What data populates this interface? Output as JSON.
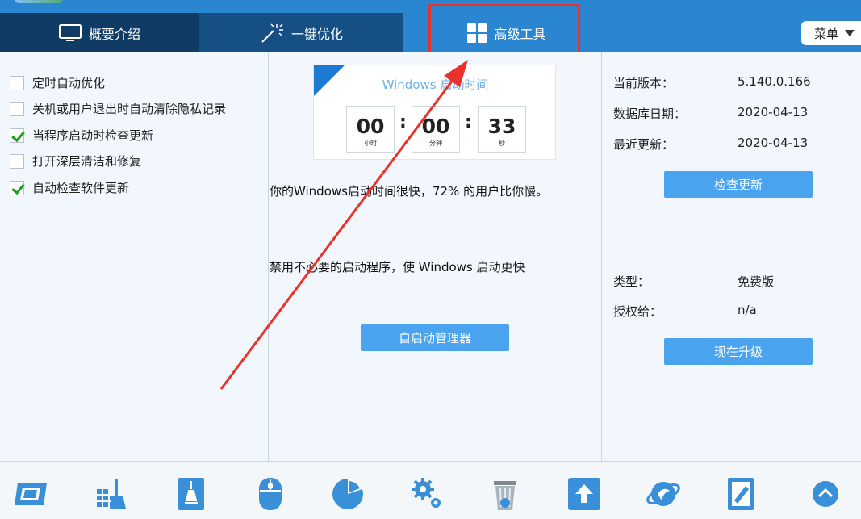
{
  "tabs": [
    {
      "label": "概要介绍",
      "icon": "monitor-icon"
    },
    {
      "label": "一键优化",
      "icon": "magic-wand-icon"
    },
    {
      "label": "高级工具",
      "icon": "grid-icon"
    }
  ],
  "menu": {
    "label": "菜单"
  },
  "options": [
    {
      "label": "定时自动优化",
      "checked": false
    },
    {
      "label": "关机或用户退出时自动清除隐私记录",
      "checked": false
    },
    {
      "label": "当程序启动时检查更新",
      "checked": true
    },
    {
      "label": "打开深层清洁和修复",
      "checked": false
    },
    {
      "label": "自动检查软件更新",
      "checked": true
    }
  ],
  "boot": {
    "title": "Windows 启动时间",
    "hours": "00",
    "hours_unit": "小时",
    "minutes": "00",
    "minutes_unit": "分钟",
    "seconds": "33",
    "seconds_unit": "秒",
    "message": "你的Windows启动时间很快，72% 的用户比你慢。",
    "tip": "禁用不必要的启动程序，使 Windows 启动更快",
    "button": "自启动管理器"
  },
  "info": {
    "version_label": "当前版本：",
    "version": "5.140.0.166",
    "db_date_label": "数据库日期：",
    "db_date": "2020-04-13",
    "last_update_label": "最近更新：",
    "last_update": "2020-04-13",
    "check_update": "检查更新",
    "type_label": "类型：",
    "type": "免费版",
    "license_label": "授权给：",
    "license": "n/a",
    "upgrade": "现在升级"
  },
  "toolbar_icons": [
    "disk-icon",
    "cleaner-icon",
    "drive-clean-icon",
    "mouse-icon",
    "pie-chart-icon",
    "settings-gears-icon",
    "recycle-bin-icon",
    "upload-icon",
    "browser-icon",
    "notebook-icon",
    "scroll-up-icon"
  ],
  "colors": {
    "accent": "#2a86d1",
    "dark_tab": "#0f3b65",
    "button": "#4aa3ee",
    "annotation": "#e8322b"
  }
}
